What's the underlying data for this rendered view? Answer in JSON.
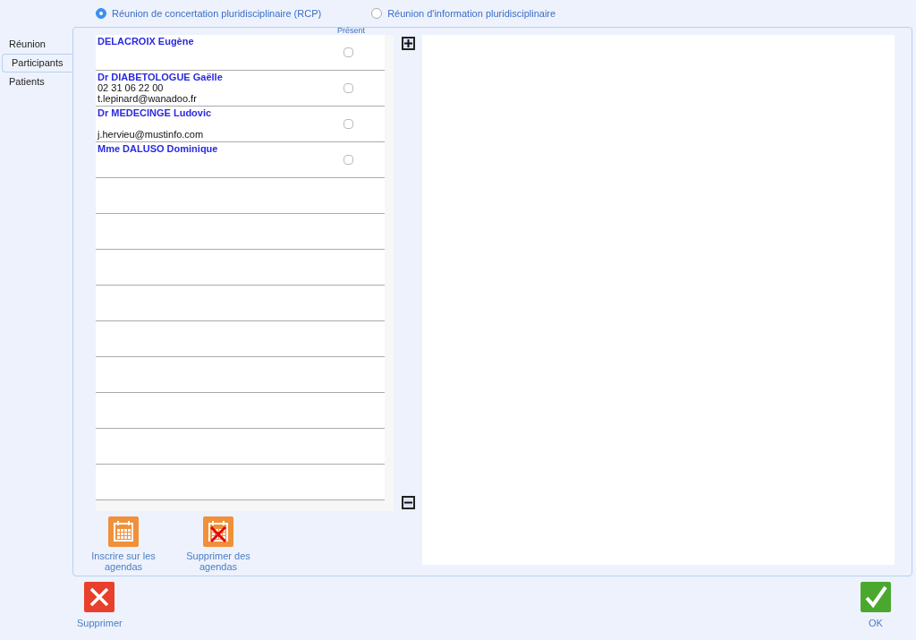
{
  "meeting_types": [
    {
      "label": "Réunion de concertation pluridisciplinaire (RCP)",
      "selected": true
    },
    {
      "label": "Réunion d'information pluridisciplinaire",
      "selected": false
    }
  ],
  "tabs": [
    {
      "label": "Réunion",
      "selected": false
    },
    {
      "label": "Participants",
      "selected": true
    },
    {
      "label": "Patients",
      "selected": false
    }
  ],
  "participants": {
    "column_header": "Présent",
    "rows": [
      {
        "name": "DELACROIX Eugène",
        "phone": "",
        "email": "",
        "present": false
      },
      {
        "name": "Dr DIABETOLOGUE Gaëlle",
        "phone": "02 31 06 22 00",
        "email": "t.lepinard@wanadoo.fr",
        "present": false
      },
      {
        "name": "Dr MEDECINGE Ludovic",
        "phone": "",
        "email": "j.hervieu@mustinfo.com",
        "present": false
      },
      {
        "name": "Mme DALUSO Dominique",
        "phone": "",
        "email": "",
        "present": false
      }
    ]
  },
  "agenda_buttons": [
    {
      "label": "Inscrire sur les agendas",
      "kind": "add"
    },
    {
      "label": "Supprimer des agendas",
      "kind": "remove"
    }
  ],
  "footer": {
    "delete": "Supprimer",
    "ok": "OK"
  }
}
